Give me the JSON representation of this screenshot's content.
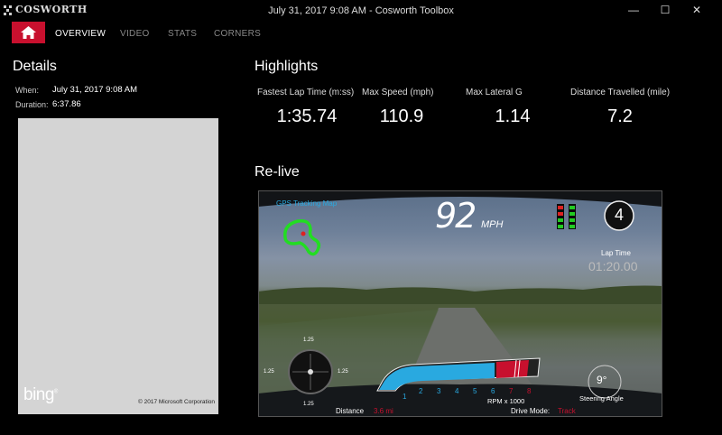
{
  "window": {
    "app_name": "COSWORTH",
    "title": "July 31, 2017 9:08 AM - Cosworth Toolbox",
    "minimize": "—",
    "maximize": "☐",
    "close": "✕"
  },
  "nav": {
    "home_icon": "home-icon",
    "tabs": [
      "OVERVIEW",
      "VIDEO",
      "STATS",
      "CORNERS"
    ],
    "active_tab": "OVERVIEW"
  },
  "details": {
    "heading": "Details",
    "when_label": "When:",
    "when_value": "July 31, 2017 9:08 AM",
    "duration_label": "Duration:",
    "duration_value": "6:37.86",
    "map_brand": "bing",
    "map_copyright": "© 2017 Microsoft Corporation"
  },
  "highlights": {
    "heading": "Highlights",
    "stats": [
      {
        "label": "Fastest Lap Time (m:ss)",
        "value": "1:35.74"
      },
      {
        "label": "Max Speed (mph)",
        "value": "110.9"
      },
      {
        "label": "Max Lateral G",
        "value": "1.14"
      },
      {
        "label": "Distance Travelled (mile)",
        "value": "7.2"
      }
    ]
  },
  "relive": {
    "heading": "Re-live",
    "gps_label": "GPS Tracking Map",
    "speed": "92",
    "speed_unit": "MPH",
    "gear": "4",
    "lap_time_label": "Lap Time",
    "lap_time": "01:20.00",
    "g_top": "1.25",
    "g_left": "1.25",
    "g_right": "1.25",
    "g_bottom": "1.25",
    "rpm_ticks": [
      "1",
      "2",
      "3",
      "4",
      "5",
      "6",
      "7",
      "8"
    ],
    "rpm_label": "RPM x 1000",
    "rpm_fill": 0.7,
    "steering_value": "9°",
    "steering_label": "Steering Angle",
    "distance_label": "Distance",
    "distance_value": "3.6 mi",
    "drive_mode_label": "Drive Mode:",
    "drive_mode_value": "Track",
    "colors": {
      "accent": "#c8102e",
      "gps": "#22dd22",
      "rpm": "#29a9e0"
    }
  }
}
